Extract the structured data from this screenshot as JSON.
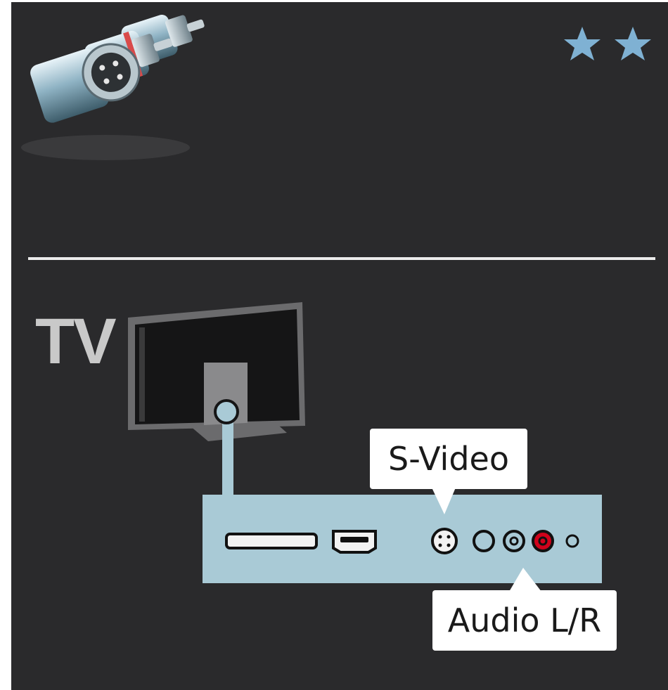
{
  "difficulty": {
    "stars": 2,
    "star_icon": "star-icon",
    "color": "#7fb1d3"
  },
  "header_icon": "connector-plugs-icon",
  "tv_label": "TV",
  "device": {
    "icon": "device-rear-panel",
    "panel_color": "#a9cad6",
    "ports": [
      {
        "icon": "card-slot-port"
      },
      {
        "icon": "hdmi-port"
      },
      {
        "icon": "s-video-port"
      },
      {
        "icon": "video-port"
      },
      {
        "icon": "audio-l-port"
      },
      {
        "icon": "audio-r-port"
      },
      {
        "icon": "small-jack-port"
      }
    ]
  },
  "callouts": {
    "s_video": "S-Video",
    "audio": "Audio L/R"
  },
  "colors": {
    "background": "#2a2a2c",
    "divider": "#ececec",
    "cable": "#a9cad6",
    "audio_right": "#d0021b"
  }
}
